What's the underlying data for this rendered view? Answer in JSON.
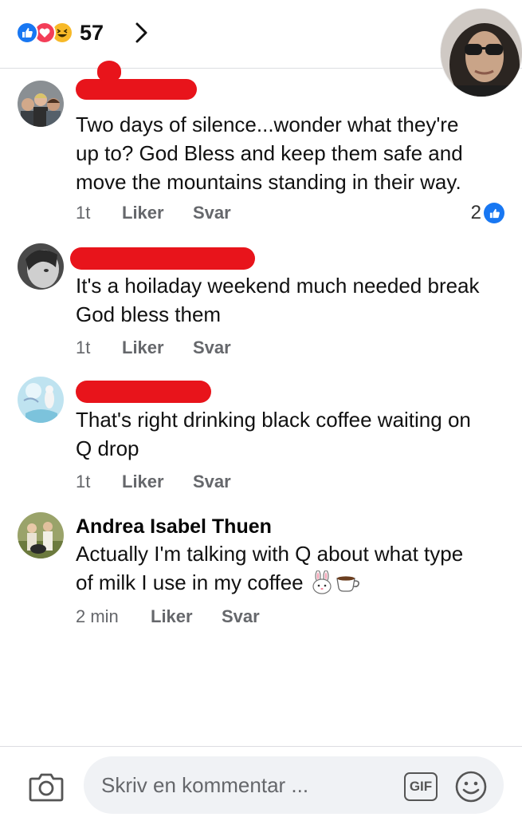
{
  "header": {
    "reaction_icons": [
      "like-icon",
      "love-icon",
      "haha-icon"
    ],
    "reaction_count": "57"
  },
  "comments": [
    {
      "author": "",
      "author_redacted": true,
      "lines": [
        "Two days of silence...wonder what they're",
        "up to? God Bless and keep them safe and",
        "move the mountains standing in their way."
      ],
      "time": "1t",
      "like_label": "Liker",
      "reply_label": "Svar",
      "like_count": "2"
    },
    {
      "author": "",
      "author_redacted": true,
      "lines": [
        "It's a hoiladay weekend  much needed break",
        "God bless them"
      ],
      "time": "1t",
      "like_label": "Liker",
      "reply_label": "Svar"
    },
    {
      "author": "",
      "author_redacted": true,
      "lines": [
        "That's right drinking black coffee  waiting on",
        "Q drop"
      ],
      "time": "1t",
      "like_label": "Liker",
      "reply_label": "Svar"
    },
    {
      "author": "Andrea Isabel Thuen",
      "author_redacted": false,
      "lines": [
        "Actually I'm talking with Q about what type",
        "of milk I use in my coffee"
      ],
      "emoji": [
        "rabbit-face-emoji",
        "hot-beverage-emoji"
      ],
      "time": "2 min",
      "like_label": "Liker",
      "reply_label": "Svar"
    }
  ],
  "composer": {
    "placeholder": "Skriv en kommentar ...",
    "gif_label": "GIF"
  },
  "colors": {
    "accent": "#1877f2",
    "redaction": "#e8141b",
    "meta_text": "#65676b",
    "input_bg": "#f0f2f5"
  }
}
